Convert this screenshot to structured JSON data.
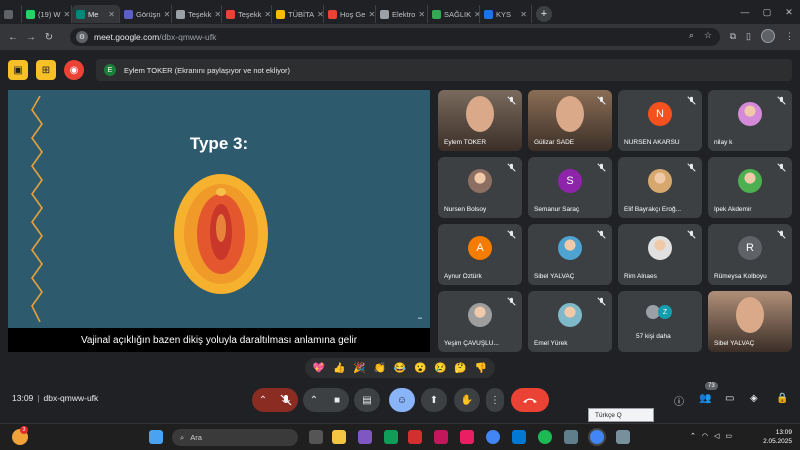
{
  "browser": {
    "tabs": [
      {
        "label": "(19) W",
        "color": "#25d366"
      },
      {
        "label": "Me",
        "color": "#00897b",
        "active": true
      },
      {
        "label": "Görüşn",
        "color": "#5b5fc7"
      },
      {
        "label": "Teşekk",
        "color": "#9aa0a6"
      },
      {
        "label": "Teşekk",
        "color": "#ea4335"
      },
      {
        "label": "TÜBİTA",
        "color": "#fbbc04"
      },
      {
        "label": "Hoş Ge",
        "color": "#ea4335"
      },
      {
        "label": "Elektro",
        "color": "#9aa0a6"
      },
      {
        "label": "SAĞLIK",
        "color": "#34a853"
      },
      {
        "label": "KYS",
        "color": "#1a73e8"
      }
    ],
    "url_host": "meet.google.com",
    "url_path": "/dbx-qmww-ufk"
  },
  "meet": {
    "presenter_initial": "E",
    "presenter_text": "Eylem TOKER (Ekranını paylaşıyor ve not ekliyor)",
    "slide_title": "Type 3:",
    "caption": "Vajinal açıklığın bazen dikiş yoluyla daraltılması anlamına gelir",
    "participants": [
      {
        "name": "Eylem TOKER",
        "kind": "video",
        "color": "#7a6a5e"
      },
      {
        "name": "Gülizar SADE",
        "kind": "video",
        "color": "#8a6d55"
      },
      {
        "name": "NURSEN AKARSU",
        "kind": "initial",
        "initial": "N",
        "color": "#f4511e"
      },
      {
        "name": "nilay k",
        "kind": "avatar",
        "color": "#d48ad8"
      },
      {
        "name": "Nursen Bolsoy",
        "kind": "avatar",
        "color": "#8d6e63"
      },
      {
        "name": "Semanur Saraç",
        "kind": "initial",
        "initial": "S",
        "color": "#8e24aa"
      },
      {
        "name": "Elif Bayrakçı Eroğ...",
        "kind": "avatar",
        "color": "#d7a86e"
      },
      {
        "name": "İpek Akdemir",
        "kind": "avatar",
        "color": "#4caf50"
      },
      {
        "name": "Aynur Öztürk",
        "kind": "initial",
        "initial": "A",
        "color": "#f57c00"
      },
      {
        "name": "Sibel YALVAÇ",
        "kind": "avatar",
        "color": "#4fa3d1"
      },
      {
        "name": "Rim Alnaes",
        "kind": "avatar",
        "color": "#e0e0e0"
      },
      {
        "name": "Rümeysa Kolboyu",
        "kind": "initial",
        "initial": "R",
        "color": "#5f6368"
      },
      {
        "name": "Yeşim ÇAVUŞLU...",
        "kind": "avatar",
        "color": "#9e9e9e"
      },
      {
        "name": "Emel Yürek",
        "kind": "avatar",
        "color": "#7fb8c9"
      },
      {
        "name": "57 kişi daha",
        "kind": "more",
        "color": "#3c4043"
      },
      {
        "name": "Sibel YALVAÇ",
        "kind": "video",
        "color": "#b08f78"
      }
    ],
    "more_initial": "Z",
    "reactions": [
      "💖",
      "👍",
      "🎉",
      "👏",
      "😂",
      "😮",
      "😢",
      "🤔",
      "👎"
    ],
    "time": "13:09",
    "meeting_code": "dbx-qmww-ufk",
    "people_count": "73",
    "lang_tooltip": "Türkçe Q"
  },
  "taskbar": {
    "notif_count": "3",
    "search_placeholder": "Ara",
    "clock_time": "13:09",
    "clock_date": "2.05.2025"
  }
}
